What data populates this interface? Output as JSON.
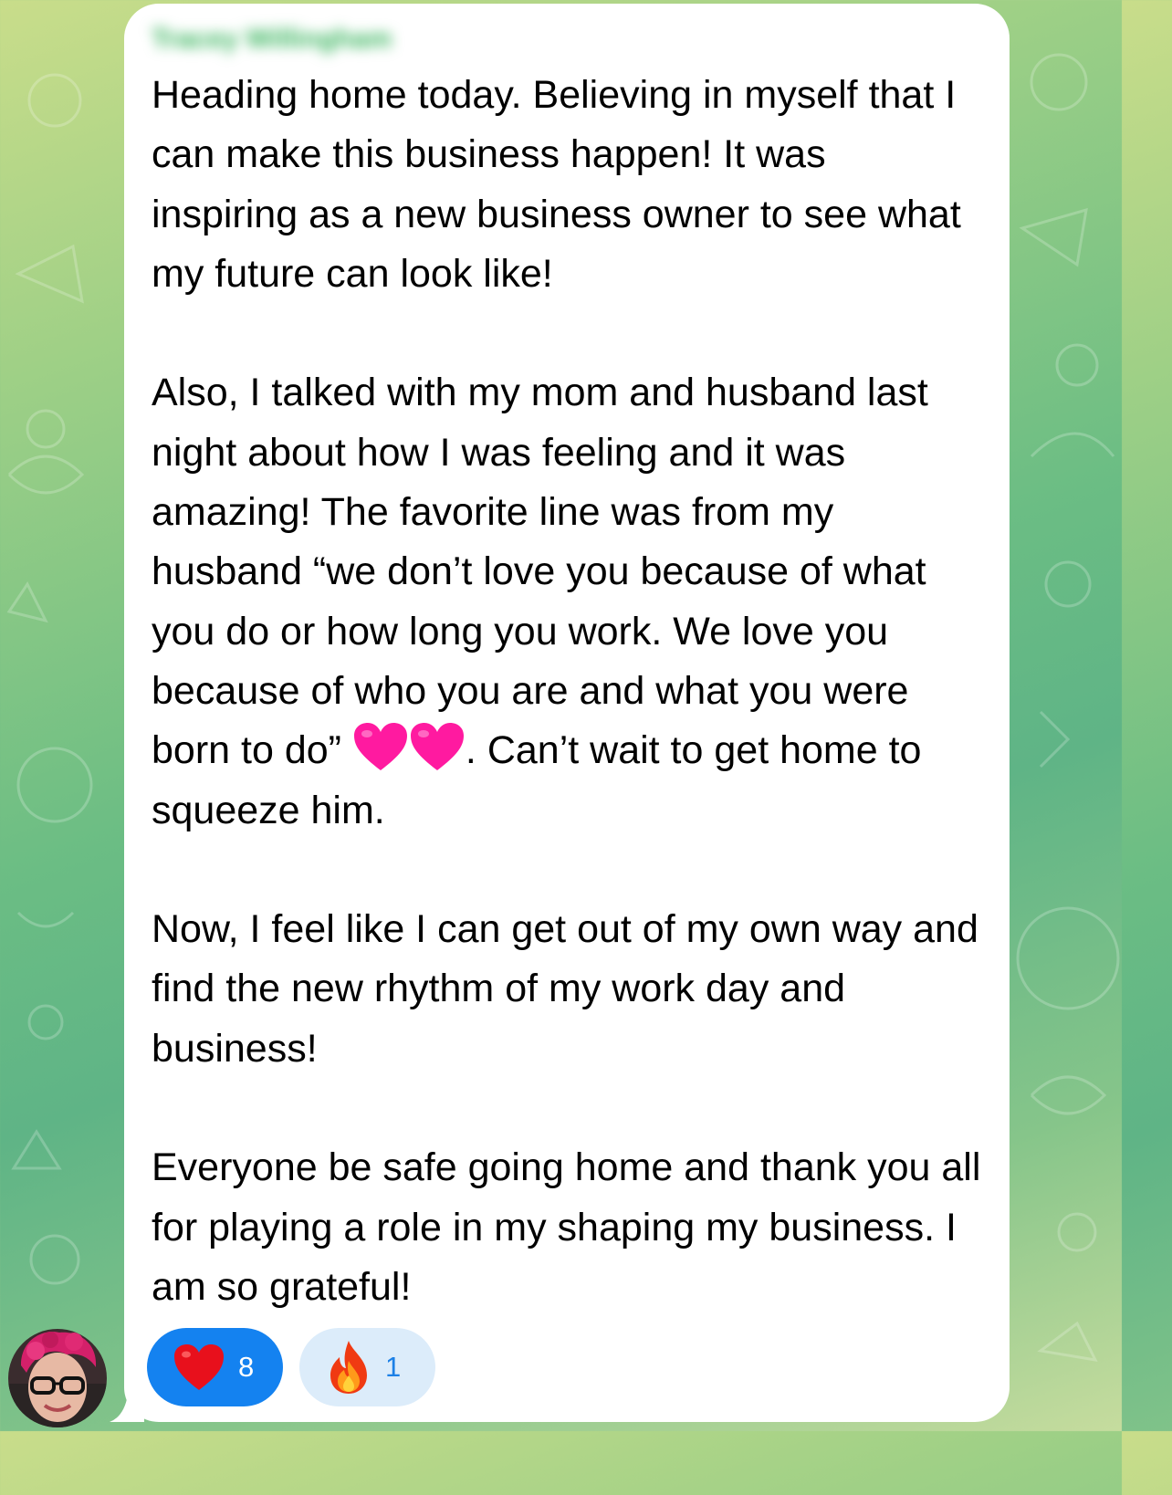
{
  "message": {
    "sender": "Tracey Willingham",
    "paragraphs": [
      "Heading home today. Believing in myself that I can make this business happen! It was inspiring as a new business owner to see what my future can look like!",
      "Also, I talked with my mom and husband last night about how I was feeling and it was amazing! The favorite line was from my husband “we don’t love you because of what you do or how long you work. We love you because of who you are and what you were born to do”",
      ". Can’t wait to get home to squeeze him.",
      "Now, I feel like I can get out of my own way and find the new rhythm of my work day and business!",
      "Everyone be safe going home and thank you all for playing a role in my shaping my business. I am so grateful!"
    ],
    "inline_emoji": "two-pink-hearts"
  },
  "reactions": [
    {
      "icon": "heart-icon",
      "count": "8",
      "selected": true
    },
    {
      "icon": "fire-icon",
      "count": "1",
      "selected": false
    }
  ],
  "colors": {
    "bubble": "#ffffff",
    "reaction_selected": "#1482f0",
    "reaction_unselected": "#dcecfa",
    "sender_name": "#35b35a",
    "heart": "#ff1493"
  }
}
